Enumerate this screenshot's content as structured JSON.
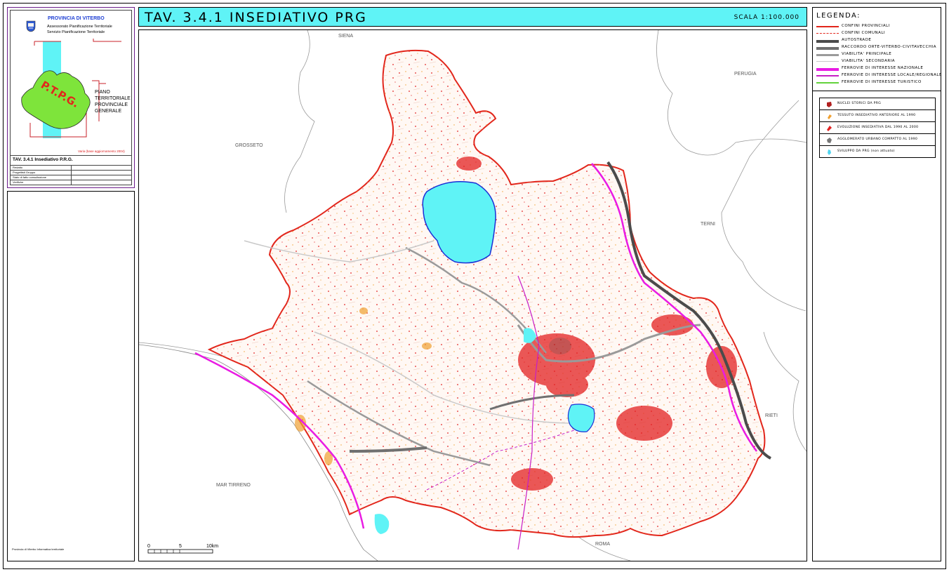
{
  "header": {
    "title": "TAV. 3.4.1 INSEDIATIVO PRG",
    "scale": "SCALA 1:100.000"
  },
  "title_card": {
    "province": "PROVINCIA DI VITERBO",
    "offices": [
      "Assessorato Pianificazione Territoriale",
      "Servizio Pianificazione Territoriale"
    ],
    "ptpg_letters": "P.T.P.G.",
    "plan_name_lines": [
      "PIANO",
      "TERRITORIALE",
      "PROVINCIALE",
      "GENERALE"
    ],
    "update_note": "Varia (base aggiornamento 2004)",
    "sheet_title": "TAV. 3.4.1 Insediativo P.R.G.",
    "rows": [
      "Redatto",
      "Progettisti Gruppo",
      "Stato di fatto consultazione",
      "Verifiche"
    ],
    "footer_credit": "Provincia di Viterbo Informatica territoriale"
  },
  "legend": {
    "heading": "LEGENDA:",
    "lines": [
      {
        "label": "CONFINI PROVINCIALI",
        "color": "#e2261b",
        "style": "solid",
        "width": 2
      },
      {
        "label": "CONFINI COMUNALI",
        "color": "#e2261b",
        "style": "dash",
        "width": 1
      },
      {
        "label": "AUTOSTRADE",
        "color": "#4b4b4b",
        "style": "solid",
        "width": 4
      },
      {
        "label": "RACCORDO ORTE-VITERBO-CIVITAVECCHIA",
        "color": "#707070",
        "style": "solid",
        "width": 4
      },
      {
        "label": "VIABILITA' PRINCIPALE",
        "color": "#9a9a9a",
        "style": "solid",
        "width": 3
      },
      {
        "label": "VIABILITA' SECONDARIA",
        "color": "#c9c9c9",
        "style": "solid",
        "width": 1
      },
      {
        "label": "FERROVIE DI INTERESSE NAZIONALE",
        "color": "#e91be3",
        "style": "solid",
        "width": 4
      },
      {
        "label": "FERROVIE DI INTERESSE LOCALE/REGIONALE",
        "color": "#c81ec6",
        "style": "solid",
        "width": 1.5
      },
      {
        "label": "FERROVIE DI INTERESSE TURISTICO",
        "color": "#63d33c",
        "style": "solid",
        "width": 1.5
      }
    ],
    "symbols": [
      {
        "label": "NUCLEI STORICI DA PRG",
        "color": "#b11f1f",
        "icon": "historic-core-icon"
      },
      {
        "label": "TESSUTO INSEDIATIVO ANTERIORE AL 1990",
        "color": "#f0a030",
        "icon": "pre1990-settlement-icon"
      },
      {
        "label": "EVOLUZIONE INSEDIATIVA DAL 1990 AL 2000",
        "color": "#e32222",
        "icon": "evolution-1990-2000-icon"
      },
      {
        "label": "AGGLOMERATO URBANO COMPATTO AL 1990",
        "color": "#777777",
        "icon": "urban-compact-icon"
      },
      {
        "label": "SVILUPPO DA PRG (non attuato)",
        "color": "#4fd4ef",
        "icon": "prg-development-icon"
      }
    ]
  },
  "map": {
    "neighbours": [
      "SIENA",
      "PERUGIA",
      "GROSSETO",
      "TERNI",
      "RIETI",
      "ROMA",
      "MAR TIRRENO"
    ],
    "scalebar": {
      "ticks": [
        "0",
        "5",
        "10km"
      ]
    },
    "colors": {
      "province_border": "#e2261b",
      "lake": "#5ff3f6",
      "lake_edge": "#1b2fd6",
      "settlement": "#e32222",
      "older": "#f0a030",
      "motorway": "#4b4b4b",
      "rail": "#e91be3"
    }
  }
}
